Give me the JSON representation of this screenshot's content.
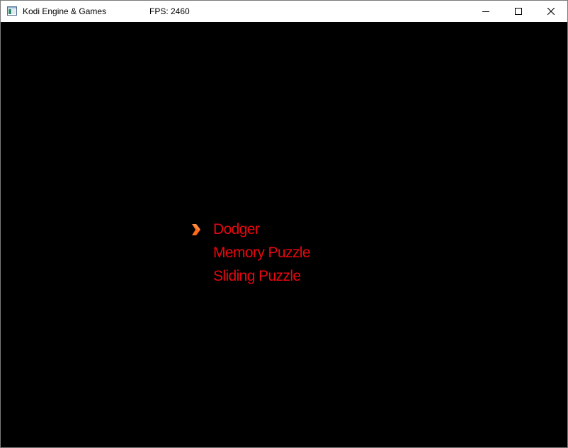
{
  "window": {
    "title": "Kodi Engine & Games",
    "fps_label": "FPS: 2460",
    "controls": {
      "minimize_icon": "minimize-icon",
      "maximize_icon": "maximize-icon",
      "close_icon": "close-icon"
    }
  },
  "game_menu": {
    "selected_index": 0,
    "selector_icon": "chevron-right-icon",
    "selector_color": "#ff6a1a",
    "item_color": "#e8070f",
    "background_color": "#000000",
    "items": [
      {
        "label": "Dodger"
      },
      {
        "label": "Memory Puzzle"
      },
      {
        "label": "Sliding Puzzle"
      }
    ]
  }
}
